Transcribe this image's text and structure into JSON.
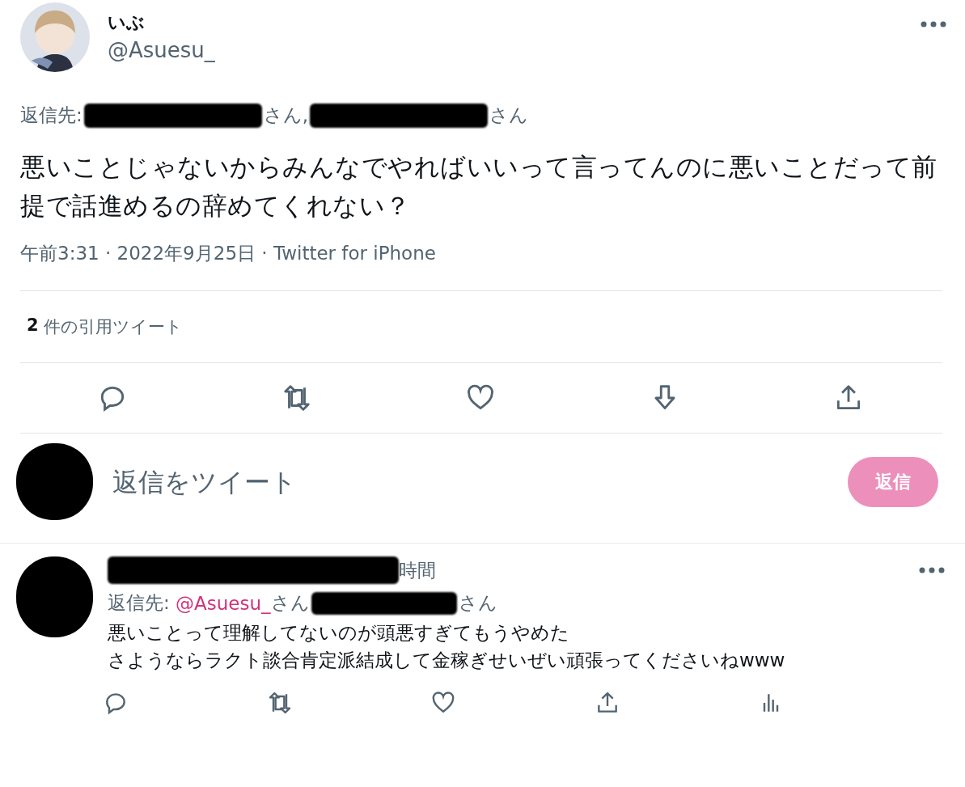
{
  "tweet": {
    "display_name": "いぶ",
    "handle": "@Asuesu_",
    "reply_to": {
      "label": "返信先:",
      "parts": [
        {
          "kind": "redacted"
        },
        {
          "kind": "text",
          "text": "さん,"
        },
        {
          "kind": "redacted"
        },
        {
          "kind": "text",
          "text": "さん"
        }
      ]
    },
    "text": "悪いことじゃないからみんなでやればいいって言ってんのに悪いことだって前提で話進めるの辞めてくれない？",
    "meta": "午前3:31 · 2022年9月25日 · Twitter for iPhone",
    "quote_count": "2",
    "quote_label": "件の引用ツイート",
    "actions": [
      {
        "kind": "reply"
      },
      {
        "kind": "retweet"
      },
      {
        "kind": "like"
      },
      {
        "kind": "bookmark"
      },
      {
        "kind": "share"
      }
    ]
  },
  "composer": {
    "placeholder": "返信をツイート",
    "button": {
      "label": "返信",
      "disabled": true
    }
  },
  "replies": [
    {
      "time": "時間",
      "reply_to": {
        "label": "返信先:",
        "parts": [
          {
            "kind": "link",
            "text": "@Asuesu_"
          },
          {
            "kind": "text",
            "text": "さん"
          },
          {
            "kind": "redacted"
          },
          {
            "kind": "text",
            "text": "さん"
          }
        ]
      },
      "lines": [
        "悪いことって理解してないのが頭悪すぎてもうやめた",
        "さようならラクト談合肯定派結成して金稼ぎせいぜい頑張ってくださいねwww"
      ],
      "actions": [
        {
          "kind": "reply"
        },
        {
          "kind": "retweet"
        },
        {
          "kind": "like"
        },
        {
          "kind": "share"
        },
        {
          "kind": "stats"
        }
      ]
    }
  ]
}
